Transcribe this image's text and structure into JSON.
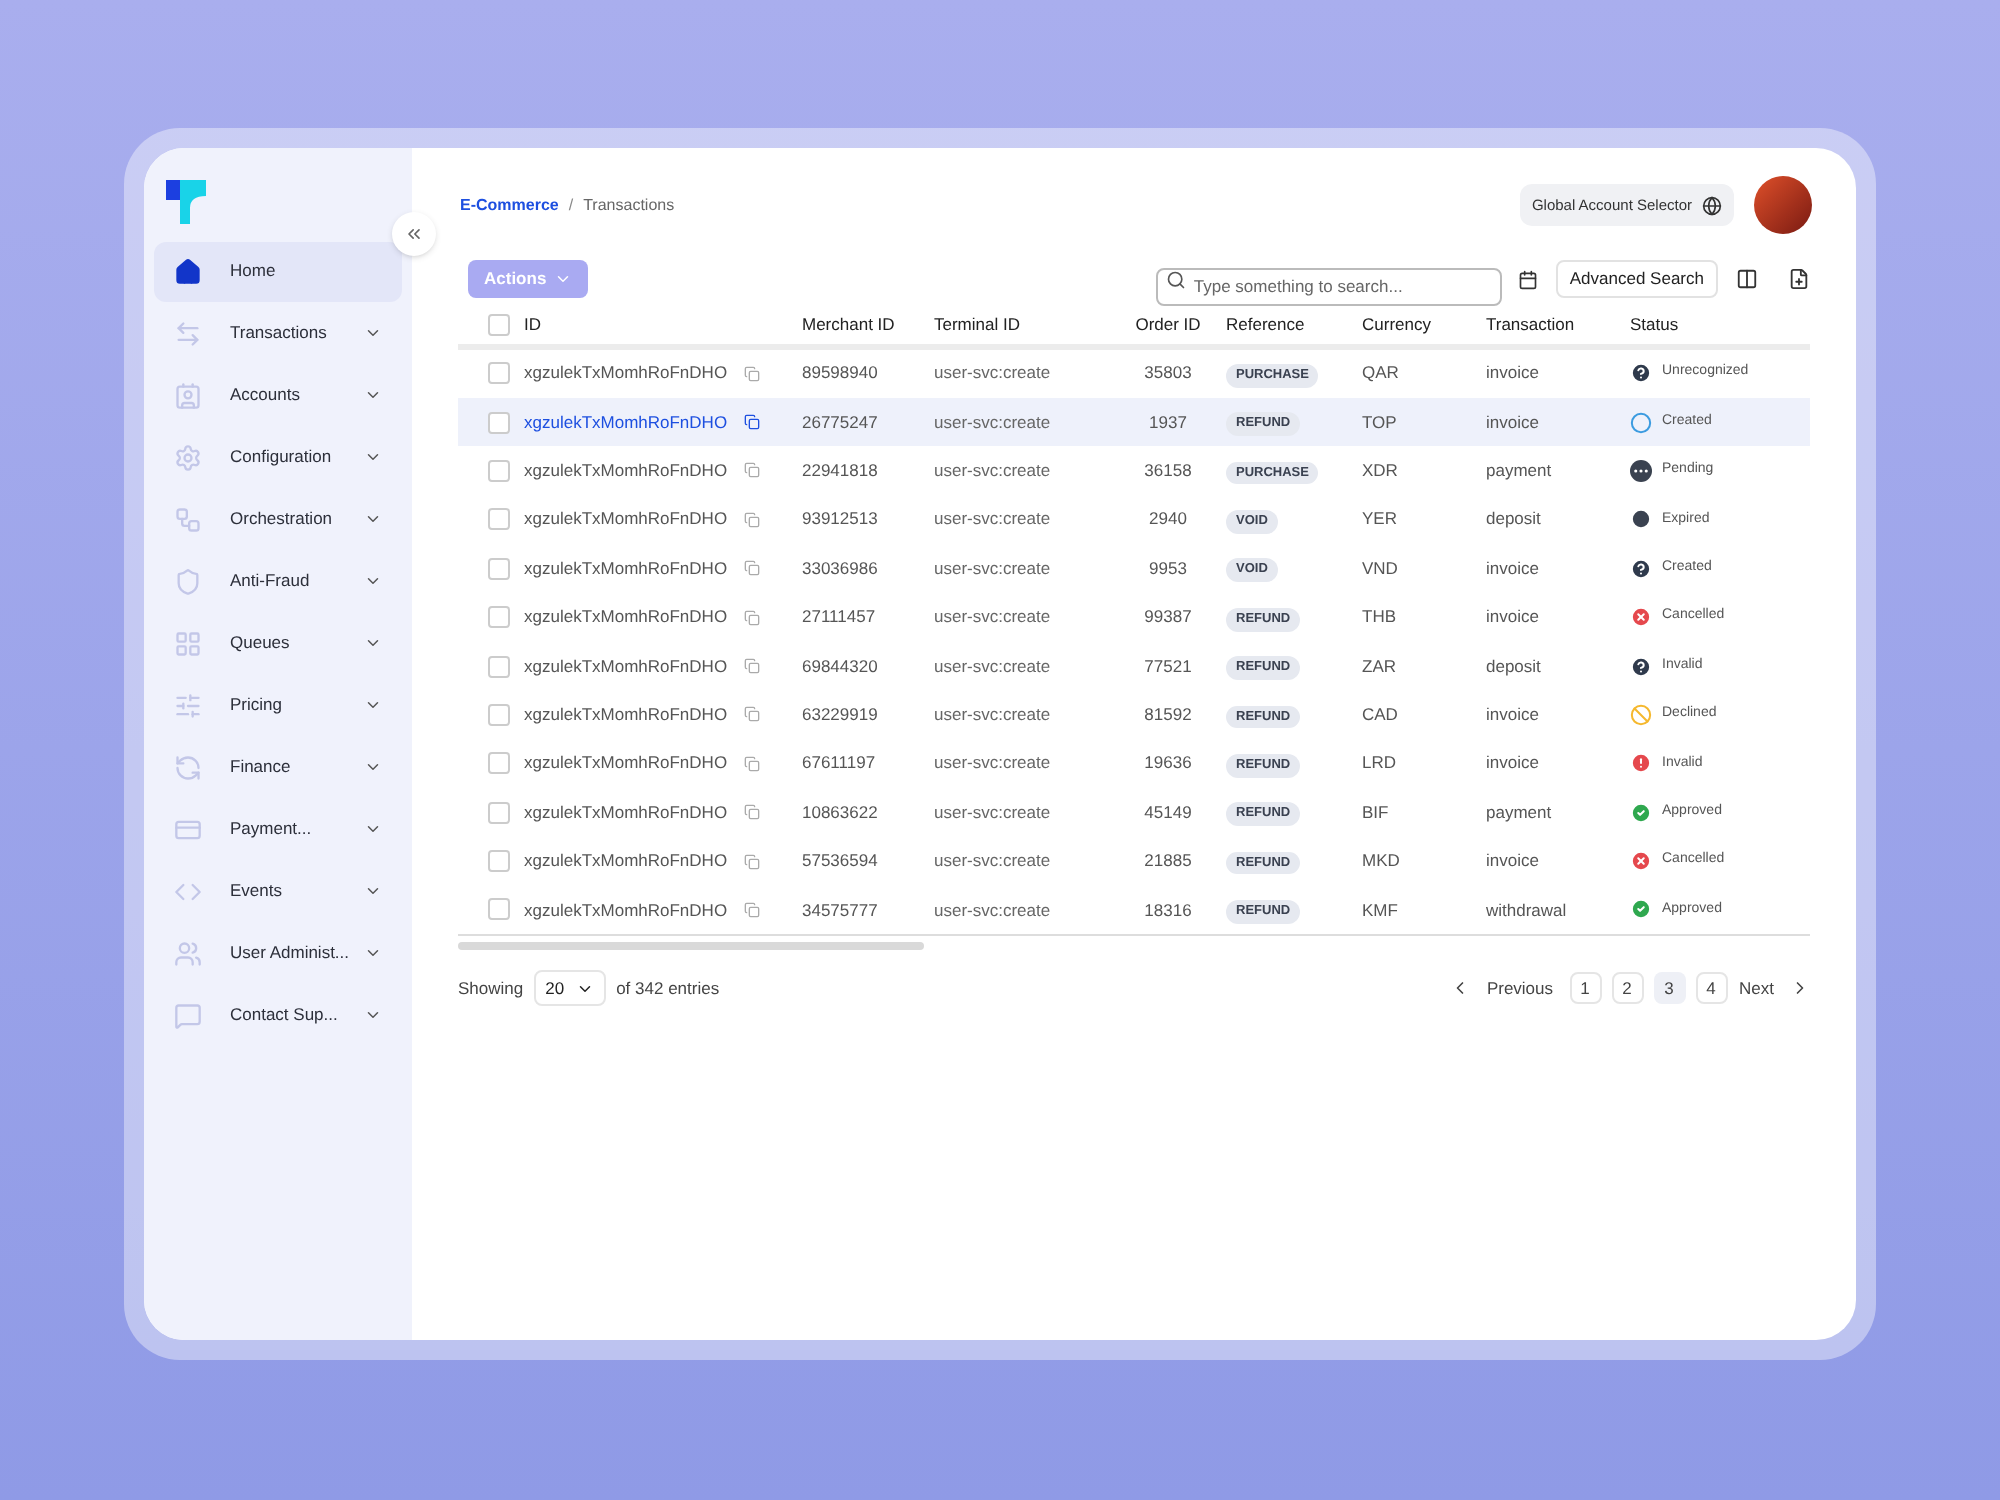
{
  "sidebar": {
    "items": [
      {
        "label": "Home",
        "selected": true,
        "expandable": false
      },
      {
        "label": "Transactions",
        "selected": false,
        "expandable": true
      },
      {
        "label": "Accounts",
        "selected": false,
        "expandable": true
      },
      {
        "label": "Configuration",
        "selected": false,
        "expandable": true
      },
      {
        "label": "Orchestration",
        "selected": false,
        "expandable": true
      },
      {
        "label": "Anti-Fraud",
        "selected": false,
        "expandable": true
      },
      {
        "label": "Queues",
        "selected": false,
        "expandable": true
      },
      {
        "label": "Pricing",
        "selected": false,
        "expandable": true
      },
      {
        "label": "Finance",
        "selected": false,
        "expandable": true
      },
      {
        "label": "Payment...",
        "selected": false,
        "expandable": true
      },
      {
        "label": "Events",
        "selected": false,
        "expandable": true
      },
      {
        "label": "User Administ...",
        "selected": false,
        "expandable": true
      },
      {
        "label": "Contact Sup...",
        "selected": false,
        "expandable": true
      }
    ]
  },
  "breadcrumb": [
    "E-Commerce",
    "Transactions"
  ],
  "breadcrumb_separator": "/",
  "account_selector": "Global Account Selector",
  "toolbar": {
    "actions": "Actions",
    "search": {
      "placeholder": "Type something to search..."
    },
    "advanced_search": "Advanced Search"
  },
  "table": {
    "columns": [
      "ID",
      "Merchant ID",
      "Terminal ID",
      "Order ID",
      "Reference",
      "Currency",
      "Transaction",
      "Status"
    ],
    "header_checked": false,
    "rows": [
      {
        "selected": false,
        "checked": false,
        "id": "xgzulekTxMomhRoFnDHO",
        "merchant_id": "89598940",
        "terminal_id": "user-svc:create",
        "order_id": "35803",
        "reference": "PURCHASE",
        "currency": "QAR",
        "transaction": "invoice",
        "status": {
          "label": "Unrecognized",
          "kind": "unknown"
        }
      },
      {
        "selected": true,
        "checked": false,
        "id": "xgzulekTxMomhRoFnDHO",
        "merchant_id": "26775247",
        "terminal_id": "user-svc:create",
        "order_id": "1937",
        "reference": "REFUND",
        "currency": "TOP",
        "transaction": "invoice",
        "status": {
          "label": "Created",
          "kind": "created"
        }
      },
      {
        "selected": false,
        "checked": false,
        "id": "xgzulekTxMomhRoFnDHO",
        "merchant_id": "22941818",
        "terminal_id": "user-svc:create",
        "order_id": "36158",
        "reference": "PURCHASE",
        "currency": "XDR",
        "transaction": "payment",
        "status": {
          "label": "Pending",
          "kind": "pending"
        }
      },
      {
        "selected": false,
        "checked": false,
        "id": "xgzulekTxMomhRoFnDHO",
        "merchant_id": "93912513",
        "terminal_id": "user-svc:create",
        "order_id": "2940",
        "reference": "VOID",
        "currency": "YER",
        "transaction": "deposit",
        "status": {
          "label": "Expired",
          "kind": "expired"
        }
      },
      {
        "selected": false,
        "checked": false,
        "id": "xgzulekTxMomhRoFnDHO",
        "merchant_id": "33036986",
        "terminal_id": "user-svc:create",
        "order_id": "9953",
        "reference": "VOID",
        "currency": "VND",
        "transaction": "invoice",
        "status": {
          "label": "Created",
          "kind": "unknown"
        }
      },
      {
        "selected": false,
        "checked": false,
        "id": "xgzulekTxMomhRoFnDHO",
        "merchant_id": "27111457",
        "terminal_id": "user-svc:create",
        "order_id": "99387",
        "reference": "REFUND",
        "currency": "THB",
        "transaction": "invoice",
        "status": {
          "label": "Cancelled",
          "kind": "cancelled"
        }
      },
      {
        "selected": false,
        "checked": false,
        "id": "xgzulekTxMomhRoFnDHO",
        "merchant_id": "69844320",
        "terminal_id": "user-svc:create",
        "order_id": "77521",
        "reference": "REFUND",
        "currency": "ZAR",
        "transaction": "deposit",
        "status": {
          "label": "Invalid",
          "kind": "unknown"
        }
      },
      {
        "selected": false,
        "checked": false,
        "id": "xgzulekTxMomhRoFnDHO",
        "merchant_id": "63229919",
        "terminal_id": "user-svc:create",
        "order_id": "81592",
        "reference": "REFUND",
        "currency": "CAD",
        "transaction": "invoice",
        "status": {
          "label": "Declined",
          "kind": "declined"
        }
      },
      {
        "selected": false,
        "checked": false,
        "id": "xgzulekTxMomhRoFnDHO",
        "merchant_id": "67611197",
        "terminal_id": "user-svc:create",
        "order_id": "19636",
        "reference": "REFUND",
        "currency": "LRD",
        "transaction": "invoice",
        "status": {
          "label": "Invalid",
          "kind": "alert"
        }
      },
      {
        "selected": false,
        "checked": false,
        "id": "xgzulekTxMomhRoFnDHO",
        "merchant_id": "10863622",
        "terminal_id": "user-svc:create",
        "order_id": "45149",
        "reference": "REFUND",
        "currency": "BIF",
        "transaction": "payment",
        "status": {
          "label": "Approved",
          "kind": "approved"
        }
      },
      {
        "selected": false,
        "checked": false,
        "id": "xgzulekTxMomhRoFnDHO",
        "merchant_id": "57536594",
        "terminal_id": "user-svc:create",
        "order_id": "21885",
        "reference": "REFUND",
        "currency": "MKD",
        "transaction": "invoice",
        "status": {
          "label": "Cancelled",
          "kind": "cancelled"
        }
      },
      {
        "selected": false,
        "checked": false,
        "id": "xgzulekTxMomhRoFnDHO",
        "merchant_id": "34575777",
        "terminal_id": "user-svc:create",
        "order_id": "18316",
        "reference": "REFUND",
        "currency": "KMF",
        "transaction": "withdrawal",
        "status": {
          "label": "Approved",
          "kind": "approved"
        }
      }
    ]
  },
  "footer": {
    "showing": "Showing",
    "page_size": "20",
    "entries": "of 342 entries",
    "previous": "Previous",
    "next": "Next",
    "pages": [
      {
        "label": "1",
        "selected": false
      },
      {
        "label": "2",
        "selected": false
      },
      {
        "label": "3",
        "selected": true
      },
      {
        "label": "4",
        "selected": false
      }
    ]
  }
}
